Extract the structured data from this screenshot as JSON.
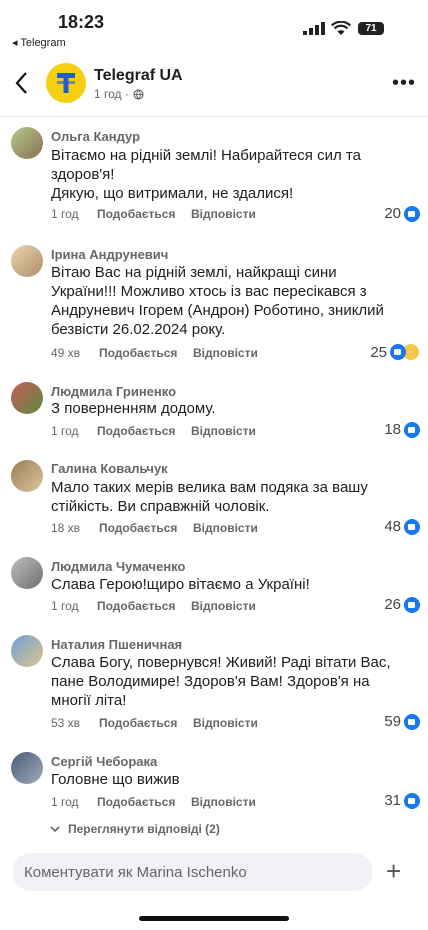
{
  "status": {
    "time": "18:23",
    "back_app": "◂ Telegram",
    "battery": "71"
  },
  "header": {
    "page_name": "Telegraf UA",
    "meta": "1 год ·"
  },
  "comments": [
    {
      "name": "Ольга Кандур",
      "text": "Вітаємо на рідній землі! Набирайтеся сил та здоров'я!\nДякую, що витримали, не здалися!",
      "time": "1 год",
      "like": "Подобається",
      "reply": "Відповісти",
      "reactions": "20"
    },
    {
      "name": "Ірина Андруневич",
      "text": "Вітаю Вас на рідній землі, найкращі      сини України!!! Можливо хтось із вас пересікався з Андруневич Ігорем (Андрон) Роботино, зниклий безвісти 26.02.2024 року.",
      "time": "49 хв",
      "like": "Подобається",
      "reply": "Відповісти",
      "reactions": "25"
    },
    {
      "name": "Людмила Гриненко",
      "text": "З поверненням додому.",
      "time": "1 год",
      "like": "Подобається",
      "reply": "Відповісти",
      "reactions": "18"
    },
    {
      "name": "Галина Ковальчук",
      "text": "Мало таких мерів велика вам подяка за вашу стійкість. Ви справжній чоловік.",
      "time": "18 хв",
      "like": "Подобається",
      "reply": "Відповісти",
      "reactions": "48"
    },
    {
      "name": "Людмила Чумаченко",
      "text": "Слава Герою!щиро вітаємо а Україні!",
      "time": "1 год",
      "like": "Подобається",
      "reply": "Відповісти",
      "reactions": "26"
    },
    {
      "name": "Наталия Пшеничная",
      "text": "Слава Богу, повернувся! Живий! Раді вітати Вас, пане Володимире! Здоров'я Вам! Здоров'я на многії літа!",
      "time": "53 хв",
      "like": "Подобається",
      "reply": "Відповісти",
      "reactions": "59"
    },
    {
      "name": "Сергій Чеборака",
      "text": "Головне що вижив",
      "time": "1 год",
      "like": "Подобається",
      "reply": "Відповісти",
      "reactions": "31"
    }
  ],
  "view_replies": "Переглянути відповіді (2)",
  "composer": {
    "placeholder": "Коментувати як Marina Ischenko"
  },
  "colors": {
    "accent": "#1877f2",
    "logo": "#f6cf12"
  }
}
